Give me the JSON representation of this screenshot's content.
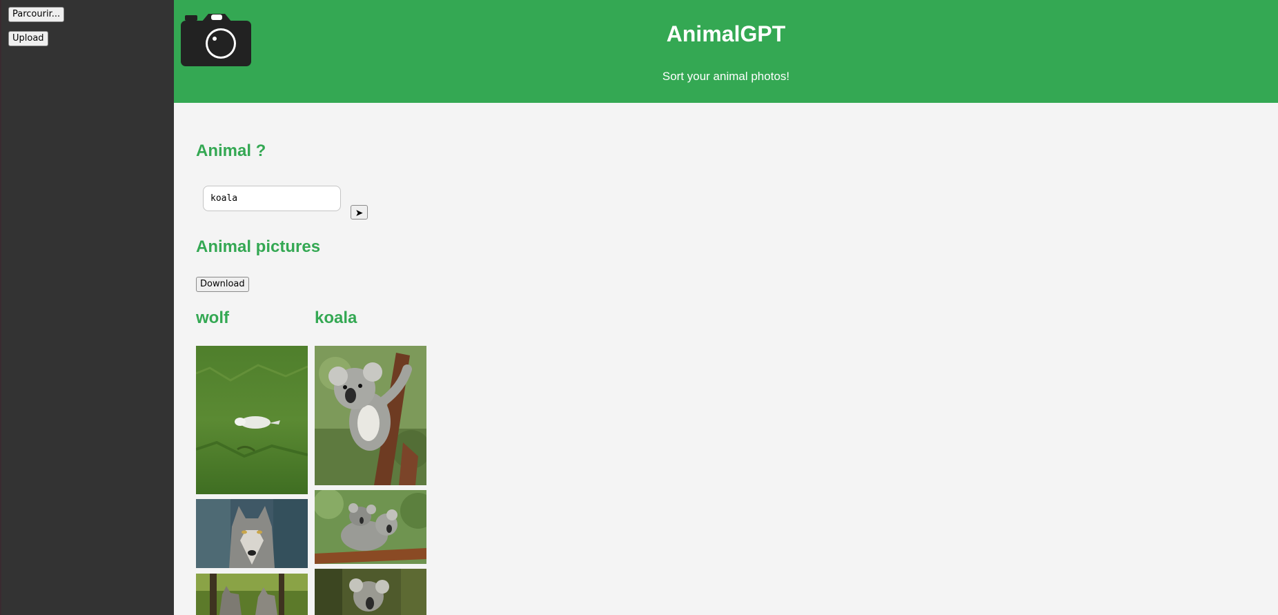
{
  "sidebar": {
    "browse_label": "Parcourir...",
    "upload_label": "Upload"
  },
  "header": {
    "title": "AnimalGPT",
    "subtitle": "Sort your animal photos!",
    "logo_icon": "camera-icon"
  },
  "query": {
    "heading": "Animal ?",
    "input_value": "koala",
    "send_label": "➤"
  },
  "gallery": {
    "heading": "Animal pictures",
    "download_label": "Download",
    "groups": [
      {
        "name": "wolf",
        "photos": [
          "white-wolf-lying-on-grass",
          "grey-wolf-portrait",
          "two-wolves-in-forest"
        ]
      },
      {
        "name": "koala",
        "photos": [
          "koala-climbing-tree",
          "koala-mother-with-baby",
          "koala-in-forest"
        ]
      }
    ]
  },
  "colors": {
    "accent": "#34a853",
    "sidebar": "#333333",
    "background": "#f4f4f4"
  }
}
